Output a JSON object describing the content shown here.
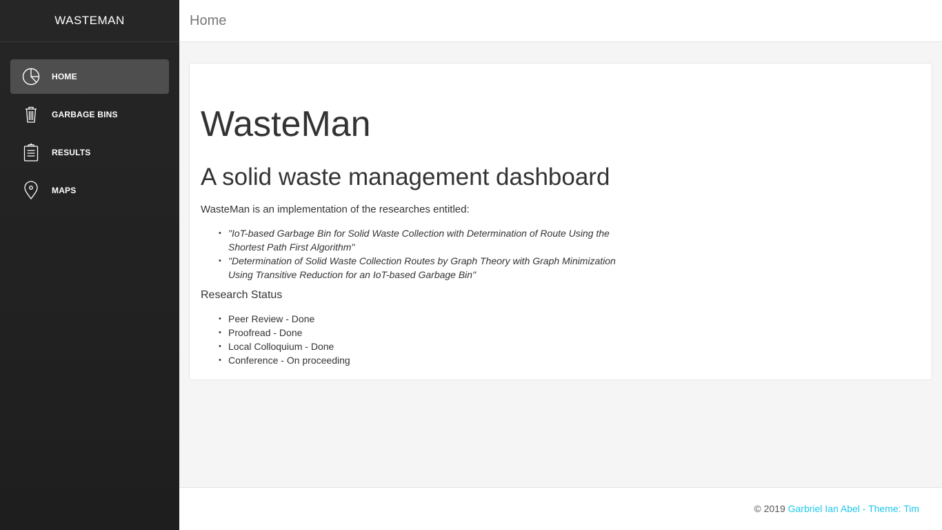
{
  "sidebar": {
    "brand": "WASTEMAN",
    "items": [
      {
        "label": "HOME",
        "icon": "pie-chart-icon",
        "active": true
      },
      {
        "label": "GARBAGE BINS",
        "icon": "trash-icon",
        "active": false
      },
      {
        "label": "RESULTS",
        "icon": "clipboard-icon",
        "active": false
      },
      {
        "label": "MAPS",
        "icon": "map-pin-icon",
        "active": false
      }
    ]
  },
  "topbar": {
    "title": "Home"
  },
  "content": {
    "title": "WasteMan",
    "subtitle": "A solid waste management dashboard",
    "intro": "WasteMan is an implementation of the researches entitled:",
    "researches": [
      "\"IoT-based Garbage Bin for Solid Waste Collection with Determination of Route Using the Shortest Path First Algorithm\"",
      "\"Determination of Solid Waste Collection Routes by Graph Theory with Graph Minimization Using Transitive Reduction for an IoT-based Garbage Bin\""
    ],
    "status_title": "Research Status",
    "status_items": [
      "Peer Review - Done",
      "Proofread - Done",
      "Local Colloquium - Done",
      "Conference - On proceeding"
    ]
  },
  "footer": {
    "copyright": "© 2019 ",
    "link_text": "Garbriel Ian Abel - Theme: Tim",
    "link_color": "#1dc7ea"
  }
}
